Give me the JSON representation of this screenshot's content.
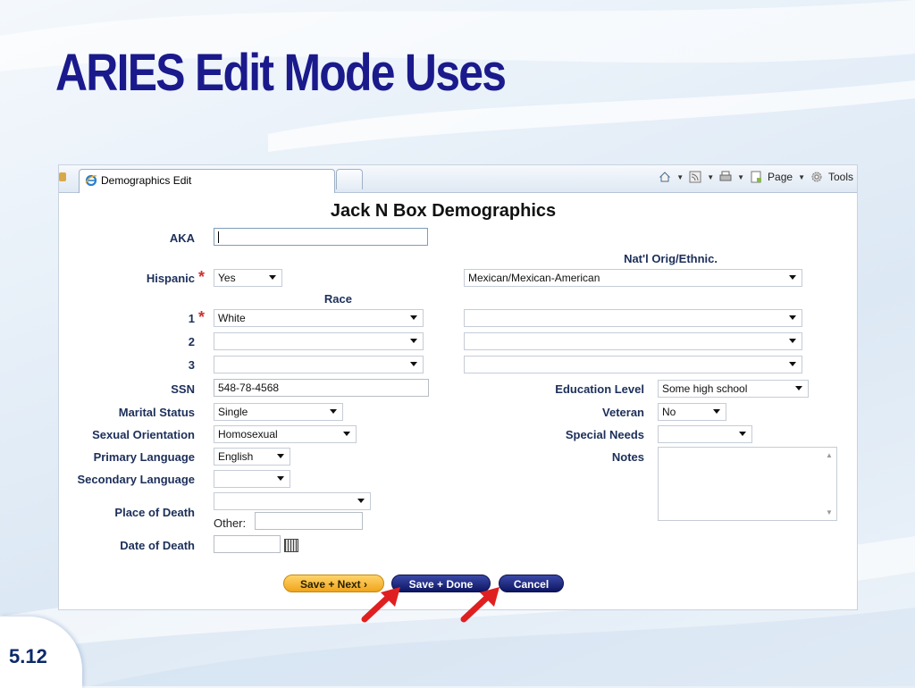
{
  "slide": {
    "title": "ARIES Edit Mode Uses",
    "number": "5.12"
  },
  "browser": {
    "tab_label": "Demographics Edit",
    "toolbar": {
      "page_label": "Page",
      "tools_label": "Tools"
    }
  },
  "form": {
    "title": "Jack N Box Demographics",
    "aka": {
      "label": "AKA",
      "value": ""
    },
    "natl_orig_label": "Nat'l Orig/Ethnic.",
    "hispanic": {
      "label": "Hispanic",
      "value": "Yes",
      "natl_orig_value": "Mexican/Mexican-American"
    },
    "race_label": "Race",
    "race_rows": [
      {
        "label": "1",
        "value": "White",
        "detail": ""
      },
      {
        "label": "2",
        "value": "",
        "detail": ""
      },
      {
        "label": "3",
        "value": "",
        "detail": ""
      }
    ],
    "ssn": {
      "label": "SSN",
      "value": "548-78-4568"
    },
    "education": {
      "label": "Education Level",
      "value": "Some high school"
    },
    "marital": {
      "label": "Marital Status",
      "value": "Single"
    },
    "veteran": {
      "label": "Veteran",
      "value": "No"
    },
    "orientation": {
      "label": "Sexual Orientation",
      "value": "Homosexual"
    },
    "special_needs": {
      "label": "Special Needs",
      "value": ""
    },
    "primary_language": {
      "label": "Primary Language",
      "value": "English"
    },
    "notes": {
      "label": "Notes",
      "value": ""
    },
    "secondary_language": {
      "label": "Secondary Language",
      "value": ""
    },
    "place_of_death": {
      "label": "Place of Death",
      "value": "",
      "other_label": "Other:",
      "other_value": ""
    },
    "date_of_death": {
      "label": "Date of Death",
      "value": ""
    },
    "buttons": {
      "save_next": "Save + Next ›",
      "save_done": "Save + Done",
      "cancel": "Cancel"
    }
  },
  "colors": {
    "title": "#1a1a8c",
    "label": "#1c2f5a",
    "required": "#d03030",
    "arrow": "#e02020"
  }
}
